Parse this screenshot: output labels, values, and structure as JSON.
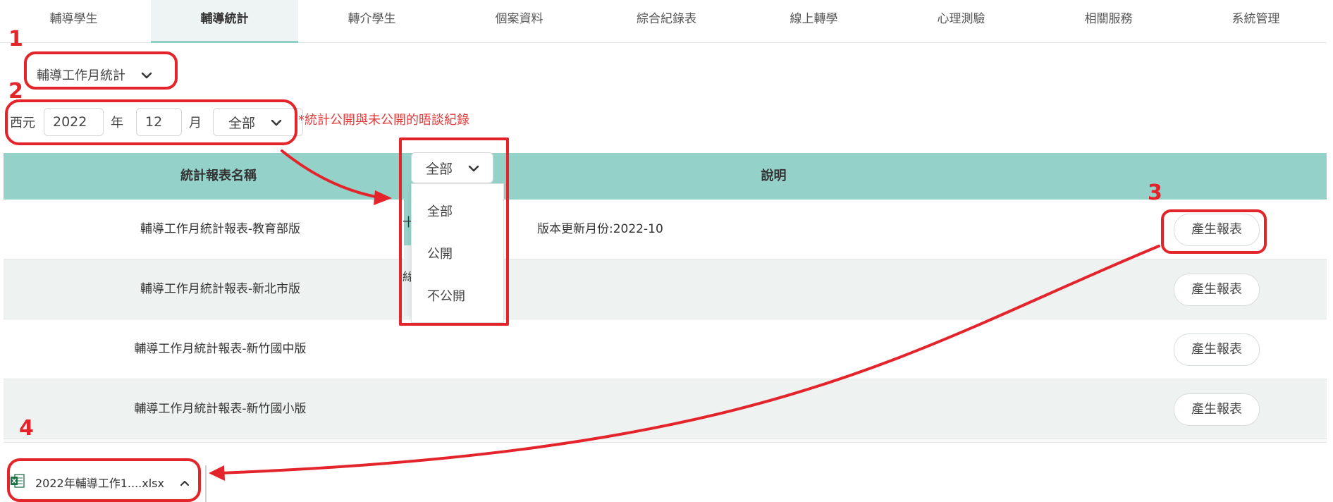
{
  "nav": {
    "tabs": [
      {
        "label": "輔導學生",
        "active": false
      },
      {
        "label": "輔導統計",
        "active": true
      },
      {
        "label": "轉介學生",
        "active": false
      },
      {
        "label": "個案資料",
        "active": false
      },
      {
        "label": "綜合紀錄表",
        "active": false
      },
      {
        "label": "線上轉學",
        "active": false
      },
      {
        "label": "心理測驗",
        "active": false
      },
      {
        "label": "相關服務",
        "active": false
      },
      {
        "label": "系統管理",
        "active": false
      }
    ]
  },
  "report_select": {
    "value": "輔導工作月統計"
  },
  "filters": {
    "era_label": "西元",
    "year_value": "2022",
    "year_unit": "年",
    "month_value": "12",
    "month_unit": "月",
    "privacy_value": "全部",
    "note": "*統計公開與未公開的晤談紀錄"
  },
  "table": {
    "headers": {
      "name": "統計報表名稱",
      "description": "說明"
    },
    "rows": [
      {
        "name": "輔導工作月統計報表-教育部版",
        "description": "版本更新月份:2022-10",
        "button": "產生報表"
      },
      {
        "name": "輔導工作月統計報表-新北市版",
        "description": "",
        "button": "產生報表"
      },
      {
        "name": "輔導工作月統計報表-新竹國中版",
        "description": "",
        "button": "產生報表"
      },
      {
        "name": "輔導工作月統計報表-新竹國小版",
        "description": "",
        "button": "產生報表"
      }
    ]
  },
  "popup": {
    "glyph_top": "十",
    "glyph_mid": "絲",
    "selected": "全部",
    "options": [
      "全部",
      "公開",
      "不公開"
    ]
  },
  "annotations": {
    "steps": [
      "1",
      "2",
      "3",
      "4"
    ],
    "color": "#e3242b"
  },
  "download": {
    "file_name": "2022年輔導工作1....xlsx",
    "icon": "excel-file-icon"
  },
  "colors": {
    "header_bg": "#93d1c9",
    "row_alt_bg": "#eef3f2",
    "note_red": "#e23b3b"
  }
}
